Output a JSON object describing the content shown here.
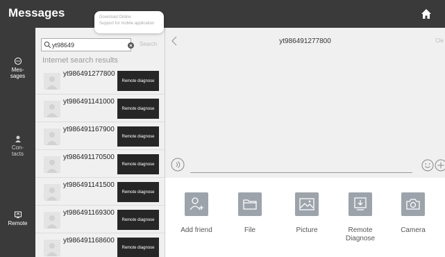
{
  "app": {
    "title": "Messages"
  },
  "popup": {
    "line1": "Download Online",
    "line2": "Support for mobile application"
  },
  "nav": [
    {
      "label": "Mes-\nsages",
      "icon": "chat-icon"
    },
    {
      "label": "Con-\ntacts",
      "icon": "contacts-icon"
    },
    {
      "label": "Remote",
      "icon": "remote-icon"
    }
  ],
  "search": {
    "value": "yt98649",
    "button": "Search"
  },
  "results": {
    "label": "Internet search results",
    "items": [
      {
        "name": "yt986491277800",
        "action": "Remote diagnose"
      },
      {
        "name": "yt986491141000",
        "action": "Remote diagnose"
      },
      {
        "name": "yt986491167900",
        "action": "Remote diagnose"
      },
      {
        "name": "yt986491170500",
        "action": "Remote diagnose"
      },
      {
        "name": "yt986491141500",
        "action": "Remote diagnose"
      },
      {
        "name": "yt986491169300",
        "action": "Remote diagnose"
      },
      {
        "name": "yt986491168600",
        "action": "Remote diagnose"
      }
    ]
  },
  "chat": {
    "title": "yt986491277800",
    "header_right": "Cle",
    "tools": [
      {
        "label": "Add friend",
        "icon": "add-friend-icon"
      },
      {
        "label": "File",
        "icon": "folder-icon"
      },
      {
        "label": "Picture",
        "icon": "picture-icon"
      },
      {
        "label": "Remote\nDiagnose",
        "icon": "remote-diagnose-icon"
      },
      {
        "label": "Camera",
        "icon": "camera-icon"
      }
    ]
  }
}
